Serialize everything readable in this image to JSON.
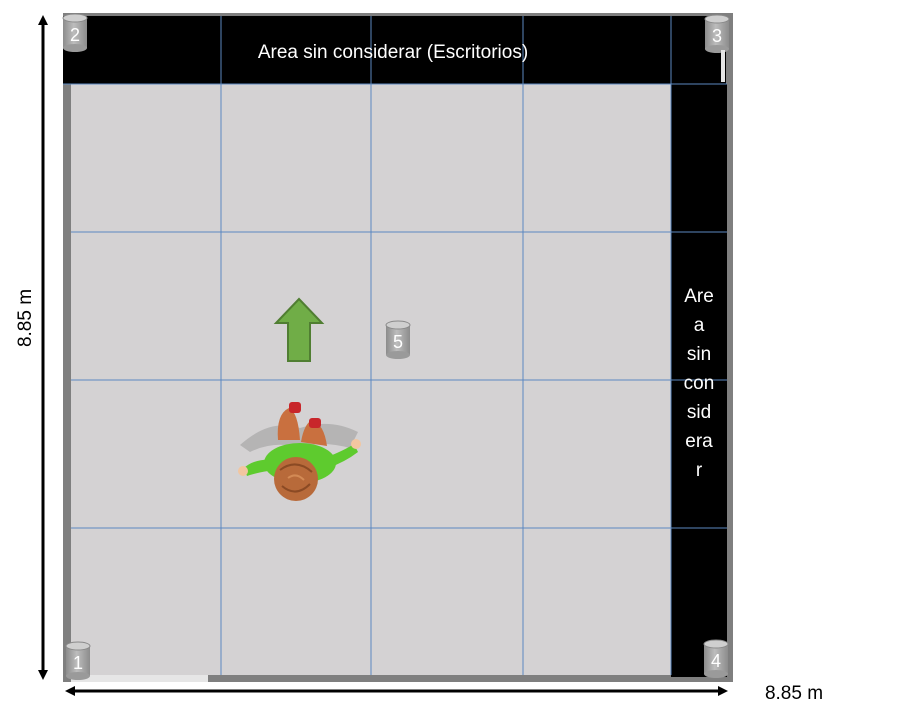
{
  "diagram": {
    "top_zone_label": "Area sin considerar (Escritorios)",
    "right_zone_label_lines": [
      "Are",
      "a",
      "sin",
      "con",
      "sid",
      "era",
      "r"
    ],
    "vertical_dimension": "8.85 m",
    "horizontal_dimension": "8.85 m",
    "markers": [
      {
        "label": "1"
      },
      {
        "label": "2"
      },
      {
        "label": "3"
      },
      {
        "label": "4"
      },
      {
        "label": "5"
      }
    ],
    "colors": {
      "floor": "#d4d2d3",
      "grid_line": "#5b88c0",
      "blocked_zone": "#000000",
      "wall": "#7f7f7f",
      "arrow_fill": "#70ad47",
      "arrow_stroke": "#507e32",
      "marker_fill": "#a5a5a5",
      "person_shirt": "#5ecb2e",
      "person_hair": "#b86a3a"
    }
  }
}
